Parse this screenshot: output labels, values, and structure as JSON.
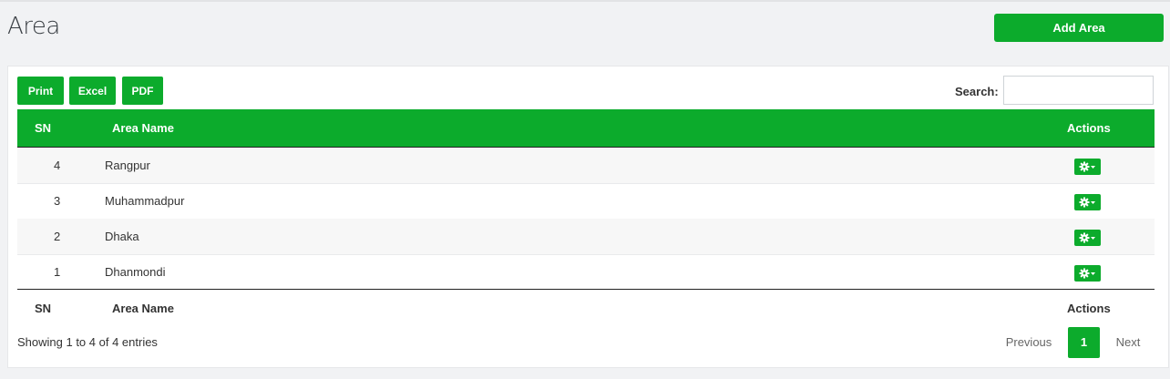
{
  "page": {
    "title": "Area",
    "add_button": "Add Area"
  },
  "toolbar": {
    "print": "Print",
    "excel": "Excel",
    "pdf": "PDF",
    "search_label": "Search:",
    "search_value": ""
  },
  "table": {
    "headers": {
      "sn": "SN",
      "area_name": "Area Name",
      "actions": "Actions"
    },
    "rows": [
      {
        "sn": "4",
        "area_name": "Rangpur"
      },
      {
        "sn": "3",
        "area_name": "Muhammadpur"
      },
      {
        "sn": "2",
        "area_name": "Dhaka"
      },
      {
        "sn": "1",
        "area_name": "Dhanmondi"
      }
    ],
    "footer": {
      "sn": "SN",
      "area_name": "Area Name",
      "actions": "Actions"
    }
  },
  "pagination": {
    "info": "Showing 1 to 4 of 4 entries",
    "previous": "Previous",
    "current": "1",
    "next": "Next"
  },
  "colors": {
    "accent": "#0cab2c"
  },
  "icons": {
    "row_action": "gear-dropdown-icon"
  }
}
